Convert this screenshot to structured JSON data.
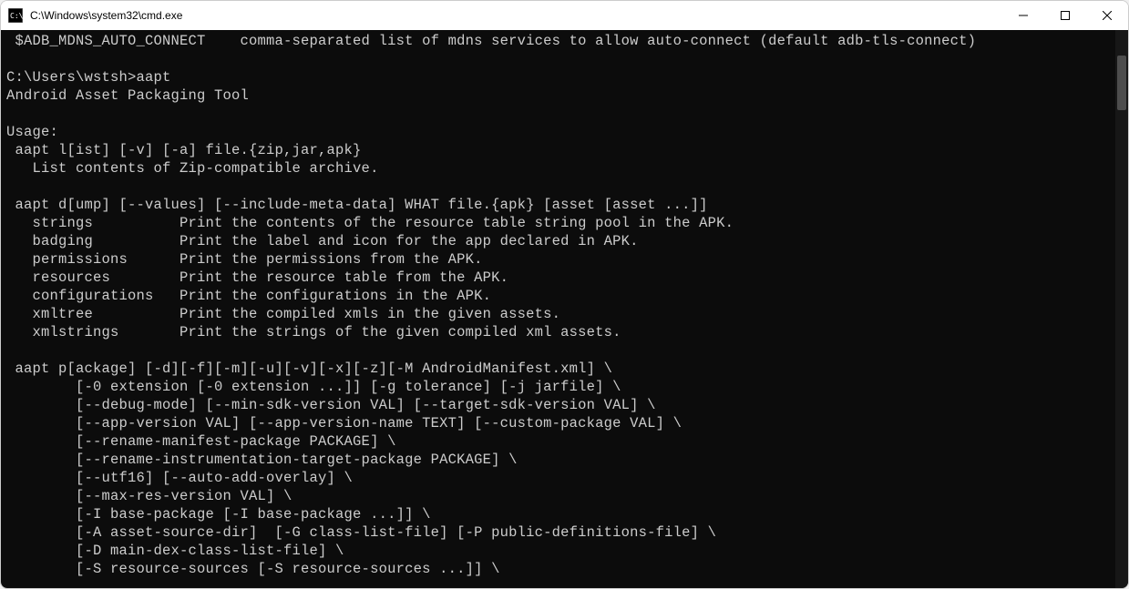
{
  "titlebar": {
    "title": "C:\\Windows\\system32\\cmd.exe"
  },
  "terminal": {
    "lines": [
      " $ADB_MDNS_AUTO_CONNECT    comma-separated list of mdns services to allow auto-connect (default adb-tls-connect)",
      "",
      "C:\\Users\\wstsh>aapt",
      "Android Asset Packaging Tool",
      "",
      "Usage:",
      " aapt l[ist] [-v] [-a] file.{zip,jar,apk}",
      "   List contents of Zip-compatible archive.",
      "",
      " aapt d[ump] [--values] [--include-meta-data] WHAT file.{apk} [asset [asset ...]]",
      "   strings          Print the contents of the resource table string pool in the APK.",
      "   badging          Print the label and icon for the app declared in APK.",
      "   permissions      Print the permissions from the APK.",
      "   resources        Print the resource table from the APK.",
      "   configurations   Print the configurations in the APK.",
      "   xmltree          Print the compiled xmls in the given assets.",
      "   xmlstrings       Print the strings of the given compiled xml assets.",
      "",
      " aapt p[ackage] [-d][-f][-m][-u][-v][-x][-z][-M AndroidManifest.xml] \\",
      "        [-0 extension [-0 extension ...]] [-g tolerance] [-j jarfile] \\",
      "        [--debug-mode] [--min-sdk-version VAL] [--target-sdk-version VAL] \\",
      "        [--app-version VAL] [--app-version-name TEXT] [--custom-package VAL] \\",
      "        [--rename-manifest-package PACKAGE] \\",
      "        [--rename-instrumentation-target-package PACKAGE] \\",
      "        [--utf16] [--auto-add-overlay] \\",
      "        [--max-res-version VAL] \\",
      "        [-I base-package [-I base-package ...]] \\",
      "        [-A asset-source-dir]  [-G class-list-file] [-P public-definitions-file] \\",
      "        [-D main-dex-class-list-file] \\",
      "        [-S resource-sources [-S resource-sources ...]] \\"
    ]
  }
}
